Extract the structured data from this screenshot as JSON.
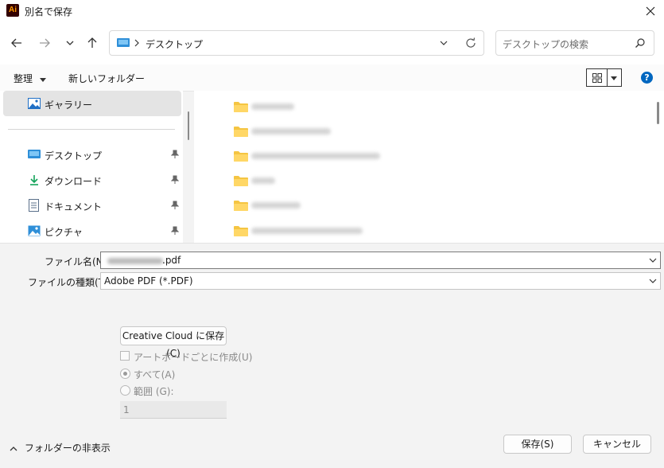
{
  "window": {
    "title": "別名で保存",
    "app_logo": "Ai"
  },
  "nav": {
    "breadcrumb": [
      "デスクトップ"
    ],
    "search_placeholder": "デスクトップの検索"
  },
  "toolbar": {
    "organize_label": "整理",
    "new_folder_label": "新しいフォルダー",
    "help_label": "?"
  },
  "sidebar": {
    "items": [
      {
        "label": "ギャラリー",
        "icon": "gallery-icon",
        "selected": true
      },
      {
        "label": "デスクトップ",
        "icon": "desktop-icon",
        "pinned": true
      },
      {
        "label": "ダウンロード",
        "icon": "download-icon",
        "pinned": true
      },
      {
        "label": "ドキュメント",
        "icon": "document-icon",
        "pinned": true
      },
      {
        "label": "ピクチャ",
        "icon": "picture-icon",
        "pinned": true
      }
    ]
  },
  "form": {
    "filename_label": "ファイル名(N):",
    "filename_value": ".pdf",
    "filetype_label": "ファイルの種類(T):",
    "filetype_value": "Adobe PDF (*.PDF)",
    "cc_button": "Creative Cloud に保存(C)",
    "artboard_checkbox": "アートボードごとに作成(U)",
    "radio_all": "すべて(A)",
    "radio_range": "範囲 (G):",
    "range_value": "1"
  },
  "footer": {
    "hide_folders": "フォルダーの非表示",
    "save_button": "保存(S)",
    "cancel_button": "キャンセル"
  },
  "colors": {
    "accent": "#0067c0",
    "folder": "#f5c542",
    "app_logo_bg": "#330000",
    "app_logo_fg": "#ff9a00"
  }
}
